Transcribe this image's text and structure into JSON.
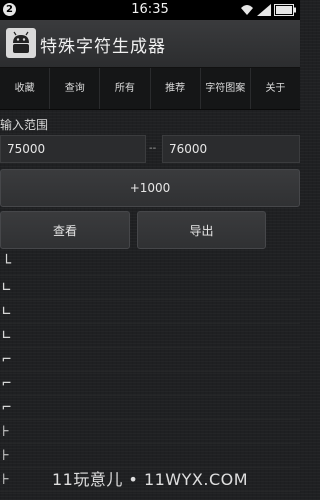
{
  "status_bar": {
    "notification_count": "2",
    "time": "16:35",
    "icons": [
      "wifi-icon",
      "signal-icon",
      "battery-icon"
    ]
  },
  "app": {
    "title": "特殊字符生成器",
    "icon": "android-app-icon"
  },
  "tabs": [
    "收藏",
    "查询",
    "所有",
    "推荐",
    "字符图案",
    "关于"
  ],
  "range": {
    "label": "输入范围",
    "start_value": "75000",
    "separator": "--",
    "end_value": "76000"
  },
  "buttons": {
    "increment": "+1000",
    "view": "查看",
    "export": "导出"
  },
  "char_list": [
    "└",
    "∟",
    "∟",
    "∟",
    "⌐",
    "⌐",
    "⌐",
    "⊦",
    "⊦",
    "⊦"
  ],
  "watermark": "11玩意儿 • 11WYX.COM",
  "colors": {
    "background": "#1f2022",
    "title_bar": "#333436",
    "tab_bar": "#151617",
    "button": "#353638"
  }
}
